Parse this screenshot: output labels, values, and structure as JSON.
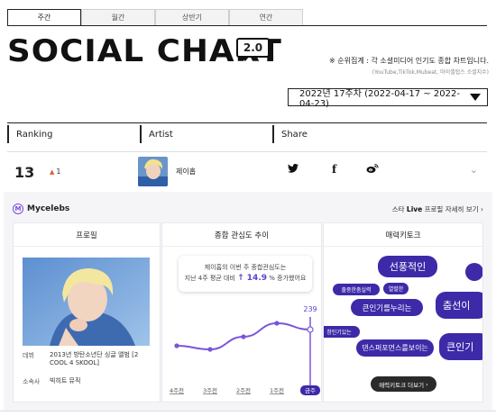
{
  "tabs": [
    "주간",
    "월간",
    "상반기",
    "연간"
  ],
  "logo": {
    "title": "SOCIAL CHART",
    "version": "2.0"
  },
  "notice": {
    "main": "※ 순위집계 : 각 소셜미디어 인기도 종합 차트입니다.",
    "sub": "(YouTube,TikTok,Mubeat, 마이셀럽스 소셜지수)"
  },
  "week_selector": {
    "value": "2022년 17주차 (2022-04-17 ~ 2022-04-23)"
  },
  "columns": {
    "ranking": "Ranking",
    "artist": "Artist",
    "share": "Share"
  },
  "rank_row": {
    "rank": "13",
    "change": "1",
    "change_direction": "up",
    "artist": "제이홉",
    "share_icons": [
      "twitter-icon",
      "facebook-icon",
      "weibo-icon"
    ]
  },
  "detail": {
    "brand": "Mycelebs",
    "star_live": {
      "prefix": "스타 ",
      "bold": "Live",
      "suffix": " 프로필 자세히 보기"
    },
    "profile": {
      "title": "프로필",
      "debut_key": "데뷔",
      "debut_value": "2013년 방탄소년단 싱글 앨범 [2 COOL 4 SKOOL]",
      "agency_key": "소속사",
      "agency_value": "빅히트 뮤직"
    },
    "trend": {
      "title": "종합 관심도 추이",
      "bubble_line1": "제이홉의 이번 주 종합관심도는",
      "bubble_line2_pre": "지난 4주 평균 대비",
      "bubble_pct": "↑ 14.9",
      "bubble_line2_post": "% 증가했어요",
      "peak_label": "239",
      "chart_data": {
        "type": "line",
        "categories": [
          "4주전",
          "3주전",
          "2주전",
          "1주전",
          "금주"
        ],
        "values": [
          190,
          186,
          200,
          215,
          208
        ],
        "highlight_label": "239"
      }
    },
    "keywords": {
      "title": "매력키토크",
      "items": [
        "선풍적인",
        "출중한춤실력",
        "열렬한",
        "큰인기를누리는",
        "춤선이",
        "창인기있는",
        "댄스퍼포먼스를보이는",
        "큰인기"
      ],
      "more_button": "매력키토크 더보기"
    }
  },
  "colors": {
    "accent": "#3d2aa8",
    "line": "#7a55d8",
    "up": "#e35a3c"
  }
}
